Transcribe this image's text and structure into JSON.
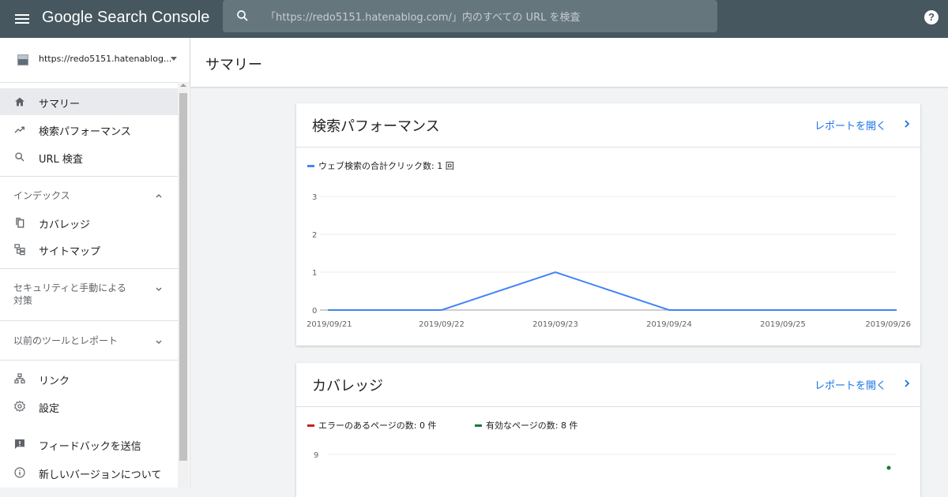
{
  "topbar": {
    "app_title": "Google Search Console",
    "search_placeholder": "「https://redo5151.hatenablog.com/」内のすべての URL を検査",
    "help_label": "?"
  },
  "sidebar": {
    "property_url": "https://redo5151.hatenablog...",
    "primary_items": [
      {
        "label": "サマリー",
        "icon": "home-icon"
      },
      {
        "label": "検索パフォーマンス",
        "icon": "trending-up-icon"
      },
      {
        "label": "URL 検査",
        "icon": "search-icon"
      }
    ],
    "index_section": {
      "label": "インデックス",
      "items": [
        {
          "label": "カバレッジ",
          "icon": "copy-icon"
        },
        {
          "label": "サイトマップ",
          "icon": "sitemap-icon"
        }
      ]
    },
    "security_section_label": "セキュリティと手動による対策",
    "security_line1": "セキュリティと手動による",
    "security_line2": "対策",
    "legacy_section_label": "以前のツールとレポート",
    "bottom_items": [
      {
        "label": "リンク",
        "icon": "links-icon"
      },
      {
        "label": "設定",
        "icon": "settings-icon"
      },
      {
        "label": "フィードバックを送信",
        "icon": "feedback-icon"
      },
      {
        "label": "新しいバージョンについて",
        "icon": "info-icon"
      }
    ]
  },
  "main": {
    "page_title": "サマリー",
    "performance_card": {
      "title": "検索パフォーマンス",
      "link": "レポートを開く",
      "legend": "ウェブ検索の合計クリック数: 1 回",
      "legend_color": "#4285f4"
    },
    "coverage_card": {
      "title": "カバレッジ",
      "link": "レポートを開く",
      "legend_error": "エラーのあるページの数: 0 件",
      "legend_error_color": "#c5221f",
      "legend_valid": "有効なページの数: 8 件",
      "legend_valid_color": "#0d7c3e",
      "y_tick_top": "9"
    }
  },
  "chart_data": {
    "type": "line",
    "x": [
      "2019/09/21",
      "2019/09/22",
      "2019/09/23",
      "2019/09/24",
      "2019/09/25",
      "2019/09/26"
    ],
    "series": [
      {
        "name": "ウェブ検索の合計クリック数: 1 回",
        "values": [
          0,
          0,
          1,
          0,
          0,
          0
        ],
        "color": "#4285f4"
      }
    ],
    "yticks": [
      "0",
      "1",
      "2",
      "3"
    ],
    "ylim": [
      0,
      3
    ],
    "grid": true
  }
}
